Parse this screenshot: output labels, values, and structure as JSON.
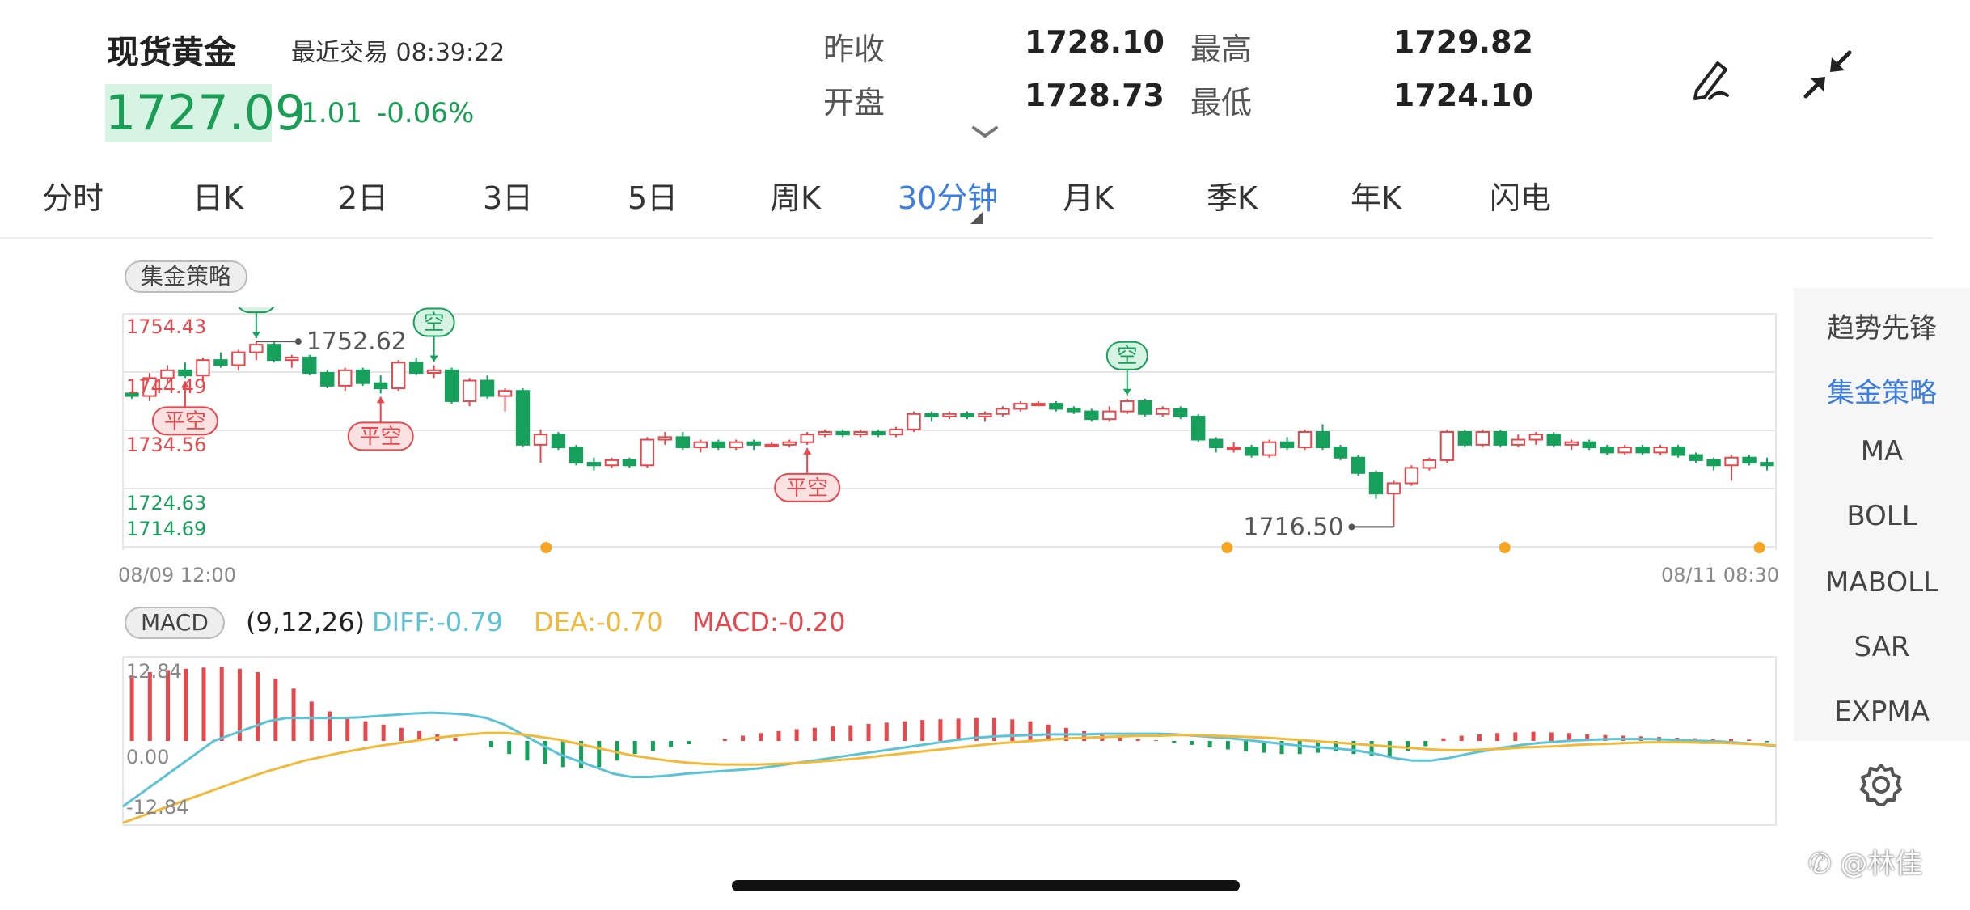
{
  "header": {
    "title": "现货黄金",
    "last_trade_label": "最近交易 08:39:22",
    "price": "1727.09",
    "change": "-1.01",
    "change_pct": "-0.06%"
  },
  "quote": {
    "prev_close_label": "昨收",
    "prev_close": "1728.10",
    "open_label": "开盘",
    "open": "1728.73",
    "high_label": "最高",
    "high": "1729.82",
    "low_label": "最低",
    "low": "1724.10"
  },
  "tabs": [
    "分时",
    "日K",
    "2日",
    "3日",
    "5日",
    "周K",
    "30分钟",
    "月K",
    "季K",
    "年K",
    "闪电"
  ],
  "active_tab": "30分钟",
  "strategy_button": "集金策略",
  "indicators": [
    "趋势先锋",
    "集金策略",
    "MA",
    "BOLL",
    "MABOLL",
    "SAR",
    "EXPMA"
  ],
  "active_indicator": "集金策略",
  "price_axis": {
    "labels": [
      "1754.43",
      "1744.49",
      "1734.56",
      "1724.63",
      "1714.69"
    ]
  },
  "time_axis": {
    "start": "08/09 12:00",
    "end": "08/11 08:30"
  },
  "annotations": {
    "max_value": "1752.62",
    "min_value": "1716.50",
    "signals": [
      {
        "label": "空",
        "kind": "short"
      },
      {
        "label": "平空",
        "kind": "close-short"
      },
      {
        "label": "平空",
        "kind": "close-short"
      },
      {
        "label": "空",
        "kind": "short"
      },
      {
        "label": "平空",
        "kind": "close-short"
      },
      {
        "label": "空",
        "kind": "short"
      }
    ]
  },
  "macd": {
    "button": "MACD",
    "params": "(9,12,26)",
    "diff_label": "DIFF:-0.79",
    "dea_label": "DEA:-0.70",
    "macd_label": "MACD:-0.20",
    "axis": [
      "12.84",
      "0.00",
      "-12.84"
    ]
  },
  "watermark": "@林佳",
  "colors": {
    "up": "#e5484d",
    "down": "#16a05c",
    "accent": "#3b7de0",
    "diff": "#5cc3d6",
    "dea": "#f0b93a"
  },
  "chart_data": {
    "type": "candlestick",
    "ylim": [
      1712,
      1758
    ],
    "x_range": [
      "08/09 12:00",
      "08/11 08:30"
    ],
    "ohlc": [
      [
        1742.5,
        1743.0,
        1741.5,
        1742.0
      ],
      [
        1742.0,
        1746.5,
        1741.0,
        1745.5
      ],
      [
        1745.5,
        1748.0,
        1744.5,
        1747.0
      ],
      [
        1747.0,
        1748.5,
        1745.5,
        1746.0
      ],
      [
        1746.0,
        1749.5,
        1745.0,
        1749.0
      ],
      [
        1749.0,
        1750.5,
        1747.5,
        1748.0
      ],
      [
        1748.0,
        1751.0,
        1747.0,
        1750.5
      ],
      [
        1750.5,
        1752.62,
        1749.0,
        1752.0
      ],
      [
        1752.0,
        1752.5,
        1748.5,
        1749.0
      ],
      [
        1749.0,
        1750.0,
        1747.5,
        1749.5
      ],
      [
        1749.5,
        1750.0,
        1746.0,
        1746.5
      ],
      [
        1746.5,
        1747.0,
        1743.5,
        1744.0
      ],
      [
        1744.0,
        1747.5,
        1743.0,
        1747.0
      ],
      [
        1747.0,
        1747.5,
        1744.0,
        1744.5
      ],
      [
        1744.5,
        1746.0,
        1742.5,
        1743.5
      ],
      [
        1743.5,
        1749.0,
        1743.0,
        1748.5
      ],
      [
        1748.5,
        1749.5,
        1746.0,
        1746.5
      ],
      [
        1746.5,
        1748.0,
        1745.5,
        1747.0
      ],
      [
        1747.0,
        1747.5,
        1740.5,
        1741.0
      ],
      [
        1741.0,
        1745.5,
        1740.0,
        1745.0
      ],
      [
        1745.0,
        1746.0,
        1741.5,
        1742.0
      ],
      [
        1742.0,
        1743.5,
        1739.0,
        1743.0
      ],
      [
        1743.0,
        1743.5,
        1732.0,
        1732.5
      ],
      [
        1732.5,
        1735.5,
        1729.0,
        1734.5
      ],
      [
        1734.5,
        1735.0,
        1731.5,
        1732.0
      ],
      [
        1732.0,
        1732.5,
        1728.5,
        1729.0
      ],
      [
        1729.0,
        1730.0,
        1727.5,
        1728.5
      ],
      [
        1728.5,
        1730.0,
        1728.0,
        1729.5
      ],
      [
        1729.5,
        1730.0,
        1728.0,
        1728.5
      ],
      [
        1728.5,
        1734.0,
        1728.0,
        1733.5
      ],
      [
        1733.5,
        1735.0,
        1732.5,
        1734.0
      ],
      [
        1734.0,
        1735.0,
        1731.5,
        1732.0
      ],
      [
        1732.0,
        1733.5,
        1731.0,
        1733.0
      ],
      [
        1733.0,
        1733.5,
        1731.5,
        1732.0
      ],
      [
        1732.0,
        1733.5,
        1731.5,
        1733.0
      ],
      [
        1733.0,
        1733.5,
        1731.5,
        1732.5
      ],
      [
        1732.5,
        1733.0,
        1732.0,
        1732.5
      ],
      [
        1732.5,
        1733.5,
        1732.0,
        1733.0
      ],
      [
        1733.0,
        1735.0,
        1732.5,
        1734.5
      ],
      [
        1734.5,
        1735.5,
        1734.0,
        1735.0
      ],
      [
        1735.0,
        1735.5,
        1734.0,
        1734.5
      ],
      [
        1734.5,
        1735.5,
        1734.0,
        1735.0
      ],
      [
        1735.0,
        1735.5,
        1734.0,
        1734.5
      ],
      [
        1734.5,
        1736.0,
        1734.0,
        1735.5
      ],
      [
        1735.5,
        1739.0,
        1735.0,
        1738.5
      ],
      [
        1738.5,
        1739.0,
        1737.0,
        1738.0
      ],
      [
        1738.0,
        1739.0,
        1737.5,
        1738.5
      ],
      [
        1738.5,
        1739.0,
        1737.5,
        1738.0
      ],
      [
        1738.0,
        1739.0,
        1737.0,
        1738.5
      ],
      [
        1738.5,
        1740.0,
        1738.0,
        1739.5
      ],
      [
        1739.5,
        1741.0,
        1739.0,
        1740.5
      ],
      [
        1740.5,
        1741.0,
        1740.0,
        1740.5
      ],
      [
        1740.5,
        1741.0,
        1739.0,
        1739.5
      ],
      [
        1739.5,
        1740.0,
        1738.5,
        1739.0
      ],
      [
        1739.0,
        1739.5,
        1737.0,
        1737.5
      ],
      [
        1737.5,
        1740.0,
        1737.0,
        1739.0
      ],
      [
        1739.0,
        1741.5,
        1738.5,
        1741.0
      ],
      [
        1741.0,
        1741.5,
        1738.0,
        1738.5
      ],
      [
        1738.5,
        1740.0,
        1738.0,
        1739.5
      ],
      [
        1739.5,
        1740.0,
        1737.5,
        1738.0
      ],
      [
        1738.0,
        1738.5,
        1733.0,
        1733.5
      ],
      [
        1733.5,
        1734.0,
        1731.0,
        1732.0
      ],
      [
        1732.0,
        1733.0,
        1731.0,
        1732.0
      ],
      [
        1732.0,
        1732.5,
        1730.0,
        1730.5
      ],
      [
        1730.5,
        1733.5,
        1730.0,
        1733.0
      ],
      [
        1733.0,
        1734.0,
        1731.5,
        1732.0
      ],
      [
        1732.0,
        1735.5,
        1731.5,
        1735.0
      ],
      [
        1735.0,
        1736.5,
        1731.5,
        1732.0
      ],
      [
        1732.0,
        1732.5,
        1729.5,
        1730.0
      ],
      [
        1730.0,
        1730.5,
        1726.5,
        1727.0
      ],
      [
        1727.0,
        1727.5,
        1722.0,
        1723.0
      ],
      [
        1723.0,
        1725.5,
        1716.5,
        1725.0
      ],
      [
        1725.0,
        1728.5,
        1724.5,
        1728.0
      ],
      [
        1728.0,
        1730.0,
        1727.5,
        1729.5
      ],
      [
        1729.5,
        1735.5,
        1729.0,
        1735.0
      ],
      [
        1735.0,
        1735.5,
        1732.0,
        1732.5
      ],
      [
        1732.5,
        1735.5,
        1732.0,
        1735.0
      ],
      [
        1735.0,
        1735.5,
        1732.0,
        1732.5
      ],
      [
        1732.5,
        1734.5,
        1732.0,
        1733.5
      ],
      [
        1733.5,
        1735.0,
        1732.5,
        1734.5
      ],
      [
        1734.5,
        1735.0,
        1732.0,
        1732.5
      ],
      [
        1732.5,
        1733.5,
        1731.5,
        1733.0
      ],
      [
        1733.0,
        1733.5,
        1731.5,
        1732.0
      ],
      [
        1732.0,
        1732.5,
        1730.5,
        1731.0
      ],
      [
        1731.0,
        1732.5,
        1730.5,
        1732.0
      ],
      [
        1732.0,
        1732.5,
        1730.5,
        1731.0
      ],
      [
        1731.0,
        1732.5,
        1730.5,
        1732.0
      ],
      [
        1732.0,
        1732.5,
        1730.0,
        1730.5
      ],
      [
        1730.5,
        1731.0,
        1729.0,
        1729.5
      ],
      [
        1729.5,
        1730.0,
        1727.5,
        1728.5
      ],
      [
        1728.5,
        1730.5,
        1725.5,
        1730.0
      ],
      [
        1730.0,
        1730.5,
        1728.5,
        1729.0
      ],
      [
        1729.0,
        1730.0,
        1727.5,
        1728.5
      ]
    ],
    "macd_hist": [
      10.0,
      10.5,
      10.8,
      11.0,
      11.2,
      11.3,
      11.0,
      10.5,
      9.5,
      8.0,
      6.0,
      4.5,
      3.5,
      3.0,
      2.5,
      2.0,
      1.5,
      1.0,
      0.5,
      0.0,
      -1.0,
      -2.0,
      -3.0,
      -3.5,
      -4.0,
      -4.2,
      -4.0,
      -3.0,
      -2.0,
      -1.5,
      -1.0,
      -0.5,
      0.0,
      0.3,
      0.8,
      1.2,
      1.5,
      1.8,
      2.0,
      2.2,
      2.4,
      2.6,
      2.8,
      3.0,
      3.2,
      3.3,
      3.4,
      3.5,
      3.5,
      3.3,
      3.0,
      2.5,
      2.0,
      1.5,
      1.0,
      0.6,
      0.3,
      0.1,
      -0.3,
      -0.6,
      -1.0,
      -1.3,
      -1.6,
      -1.8,
      -2.0,
      -2.0,
      -1.8,
      -1.6,
      -2.0,
      -2.3,
      -2.3,
      -1.5,
      -0.8,
      0.4,
      0.8,
      1.0,
      1.2,
      1.3,
      1.4,
      1.3,
      1.2,
      1.0,
      0.9,
      0.8,
      0.7,
      0.6,
      0.5,
      0.4,
      0.3,
      0.3,
      0.2,
      -0.2
    ],
    "diff": [
      -10,
      -8,
      -6,
      -4,
      -2,
      0,
      1,
      2,
      3,
      3.5,
      3.5,
      3.5,
      3.5,
      3.6,
      3.8,
      4.0,
      4.2,
      4.3,
      4.2,
      4.0,
      3.5,
      2.5,
      1.0,
      -0.5,
      -2,
      -3,
      -4,
      -5,
      -5.5,
      -5.5,
      -5.3,
      -5,
      -4.8,
      -4.6,
      -4.4,
      -4.2,
      -3.8,
      -3.4,
      -3,
      -2.6,
      -2.2,
      -1.8,
      -1.4,
      -1,
      -0.6,
      -0.2,
      0.2,
      0.5,
      0.7,
      0.8,
      0.9,
      1.0,
      1.0,
      1.0,
      1.1,
      1.1,
      1.1,
      1.1,
      1.0,
      0.8,
      0.6,
      0.4,
      0.1,
      -0.2,
      -0.5,
      -0.8,
      -1.0,
      -1.2,
      -1.5,
      -2.0,
      -2.6,
      -3.0,
      -3.0,
      -2.6,
      -2.0,
      -1.5,
      -1.0,
      -0.6,
      -0.3,
      -0.1,
      0.1,
      0.2,
      0.3,
      0.3,
      0.3,
      0.2,
      0.1,
      0,
      -0.1,
      -0.3,
      -0.5,
      -0.79
    ],
    "dea": [
      -12.5,
      -11.5,
      -10.5,
      -9.5,
      -8.5,
      -7.5,
      -6.5,
      -5.5,
      -4.6,
      -3.8,
      -3.0,
      -2.4,
      -1.8,
      -1.3,
      -0.8,
      -0.4,
      0.0,
      0.4,
      0.7,
      1.0,
      1.2,
      1.2,
      1.0,
      0.6,
      0.2,
      -0.4,
      -1.0,
      -1.6,
      -2.2,
      -2.6,
      -3.0,
      -3.3,
      -3.5,
      -3.6,
      -3.6,
      -3.6,
      -3.5,
      -3.4,
      -3.2,
      -3.0,
      -2.8,
      -2.5,
      -2.2,
      -1.9,
      -1.6,
      -1.3,
      -1.0,
      -0.7,
      -0.4,
      -0.2,
      0.0,
      0.2,
      0.4,
      0.5,
      0.6,
      0.7,
      0.8,
      0.8,
      0.9,
      0.9,
      0.8,
      0.7,
      0.6,
      0.5,
      0.3,
      0.1,
      -0.1,
      -0.3,
      -0.5,
      -0.7,
      -0.9,
      -1.1,
      -1.3,
      -1.4,
      -1.4,
      -1.3,
      -1.2,
      -1.0,
      -0.9,
      -0.8,
      -0.6,
      -0.5,
      -0.4,
      -0.3,
      -0.2,
      -0.2,
      -0.2,
      -0.3,
      -0.3,
      -0.4,
      -0.5,
      -0.7
    ],
    "macd_ylim": [
      -12.84,
      12.84
    ]
  }
}
